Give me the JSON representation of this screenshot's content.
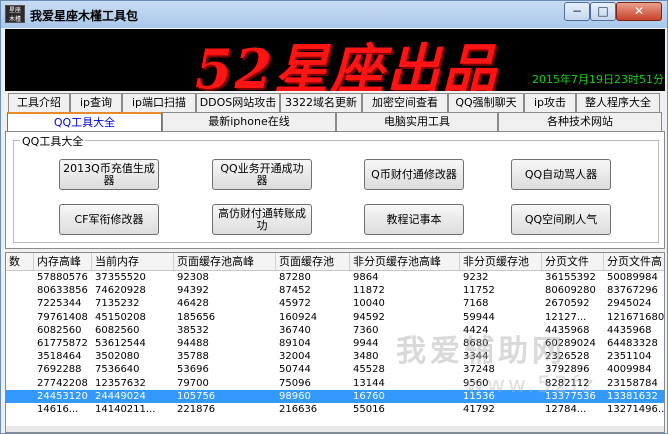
{
  "window": {
    "title": "我爱星座木槿工具包",
    "icon_label": "星座 木槿"
  },
  "controls": {
    "minimize": "−",
    "maximize": "□",
    "close": "✕"
  },
  "banner": {
    "text": "52星座出品",
    "clock": "2015年7月19日23时51分2"
  },
  "tabs_row1": [
    {
      "label": "工具介绍"
    },
    {
      "label": "ip查询"
    },
    {
      "label": "ip端口扫描"
    },
    {
      "label": "DDOS网站攻击"
    },
    {
      "label": "3322域名更新"
    },
    {
      "label": "加密空间查看"
    },
    {
      "label": "QQ强制聊天"
    },
    {
      "label": "ip攻击"
    },
    {
      "label": "整人程序大全"
    }
  ],
  "tabs_row2": [
    {
      "label": "QQ工具大全"
    },
    {
      "label": "最新iphone在线"
    },
    {
      "label": "电脑实用工具"
    },
    {
      "label": "各种技术网站"
    }
  ],
  "group": {
    "label": "QQ工具大全",
    "buttons": [
      {
        "label": "2013Q币充值生成器"
      },
      {
        "label": "QQ业务开通成功器"
      },
      {
        "label": "Q币财付通修改器"
      },
      {
        "label": "QQ自动骂人器"
      },
      {
        "label": "CF军衔修改器"
      },
      {
        "label": "高仿财付通转账成功"
      },
      {
        "label": "教程记事本"
      },
      {
        "label": "QQ空间刷人气"
      }
    ]
  },
  "table": {
    "headers": [
      "数",
      "内存高峰",
      "当前内存",
      "页面缓存池高峰",
      "页面缓存池",
      "非分页缓存池高峰",
      "非分页缓存池",
      "分页文件",
      "分页文件高"
    ],
    "rows": [
      [
        "",
        "57880576",
        "37355520",
        "92308",
        "87280",
        "9864",
        "9232",
        "36155392",
        "50089984"
      ],
      [
        "",
        "80633856",
        "74620928",
        "94392",
        "87452",
        "11872",
        "11752",
        "80609280",
        "83767296"
      ],
      [
        "",
        "7225344",
        "7135232",
        "46428",
        "45972",
        "10040",
        "7168",
        "2670592",
        "2945024"
      ],
      [
        "",
        "79761408",
        "45150208",
        "185656",
        "160924",
        "94592",
        "59944",
        "12127...",
        "121671680"
      ],
      [
        "",
        "6082560",
        "6082560",
        "38532",
        "36740",
        "7360",
        "4424",
        "4435968",
        "4435968"
      ],
      [
        "",
        "61775872",
        "53612544",
        "94488",
        "89104",
        "9944",
        "8680",
        "60289024",
        "64483328"
      ],
      [
        "",
        "3518464",
        "3502080",
        "35788",
        "32004",
        "3480",
        "3344",
        "2326528",
        "2351104"
      ],
      [
        "",
        "7692288",
        "7536640",
        "53696",
        "50744",
        "45528",
        "37248",
        "3792896",
        "4009984"
      ],
      [
        "",
        "27742208",
        "12357632",
        "79700",
        "75096",
        "13144",
        "9560",
        "8282112",
        "23158784"
      ],
      [
        "",
        "24453120",
        "24449024",
        "105756",
        "98960",
        "16760",
        "11536",
        "13377536",
        "13381632"
      ],
      [
        "",
        "14616...",
        "14140211...",
        "221876",
        "216636",
        "55016",
        "41792",
        "12784...",
        "13271496..."
      ]
    ],
    "selected_row": 9
  },
  "watermark": {
    "line1": "我爱辅助网",
    "line2": "www.52fz"
  }
}
